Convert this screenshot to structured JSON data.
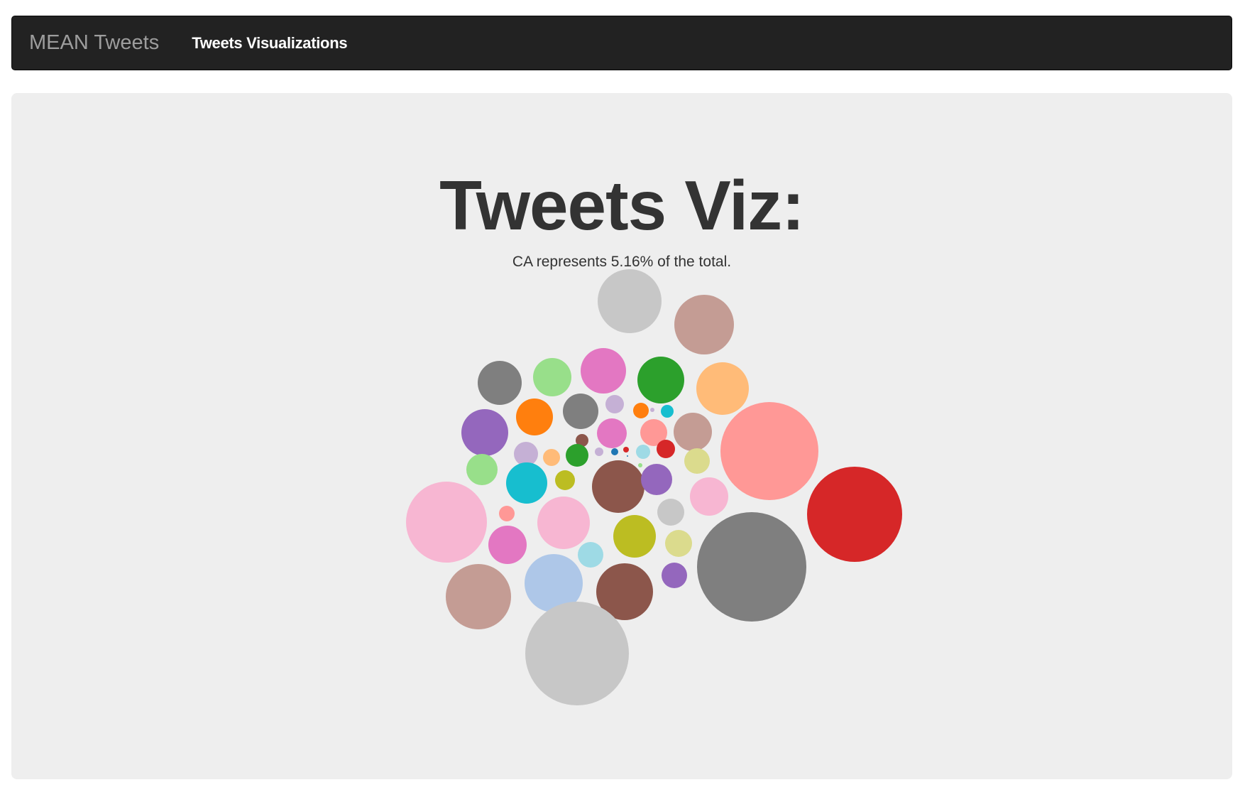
{
  "navbar": {
    "brand": "MEAN Tweets",
    "link": "Tweets Visualizations"
  },
  "page": {
    "title": "Tweets Viz:",
    "subtitle": "CA represents 5.16% of the total."
  },
  "colors": {
    "navbar_bg": "#222222",
    "brand_text": "#9d9d9d",
    "jumbotron_bg": "#eeeeee",
    "heading_text": "#333333",
    "palette": [
      "#1f77b4",
      "#aec7e8",
      "#ff7f0e",
      "#ffbb78",
      "#2ca02c",
      "#98df8a",
      "#d62728",
      "#ff9896",
      "#9467bd",
      "#c5b0d5",
      "#8c564b",
      "#c49c94",
      "#e377c2",
      "#f7b6d2",
      "#7f7f7f",
      "#c7c7c7",
      "#bcbd22",
      "#dbdb8d",
      "#17becf",
      "#9edae5"
    ]
  },
  "chart_data": {
    "type": "bubble",
    "title": "",
    "bubbles": [
      {
        "color": "#c7c7c7",
        "size": 45
      },
      {
        "color": "#c49c94",
        "size": 42
      },
      {
        "color": "#7f7f7f",
        "size": 31
      },
      {
        "color": "#98df8a",
        "size": 27
      },
      {
        "color": "#e377c2",
        "size": 32
      },
      {
        "color": "#2ca02c",
        "size": 33
      },
      {
        "color": "#ffbb78",
        "size": 37
      },
      {
        "color": "#ff7f0e",
        "size": 26
      },
      {
        "color": "#7f7f7f",
        "size": 25
      },
      {
        "color": "#c5b0d5",
        "size": 13
      },
      {
        "color": "#ff7f0e",
        "size": 11
      },
      {
        "color": "#c5b0d5",
        "size": 3
      },
      {
        "color": "#17becf",
        "size": 9
      },
      {
        "color": "#9467bd",
        "size": 33
      },
      {
        "color": "#e377c2",
        "size": 21
      },
      {
        "color": "#ff9896",
        "size": 19
      },
      {
        "color": "#c49c94",
        "size": 27
      },
      {
        "color": "#ff9896",
        "size": 69
      },
      {
        "color": "#8c564b",
        "size": 9
      },
      {
        "color": "#c5b0d5",
        "size": 17
      },
      {
        "color": "#ffbb78",
        "size": 12
      },
      {
        "color": "#2ca02c",
        "size": 16
      },
      {
        "color": "#c5b0d5",
        "size": 6
      },
      {
        "color": "#1f77b4",
        "size": 5
      },
      {
        "color": "#d62728",
        "size": 4
      },
      {
        "color": "#9edae5",
        "size": 10
      },
      {
        "color": "#d62728",
        "size": 13
      },
      {
        "color": "#1f77b4",
        "size": 1
      },
      {
        "color": "#98df8a",
        "size": 3
      },
      {
        "color": "#98df8a",
        "size": 22
      },
      {
        "color": "#17becf",
        "size": 29
      },
      {
        "color": "#bcbd22",
        "size": 14
      },
      {
        "color": "#8c564b",
        "size": 37
      },
      {
        "color": "#9467bd",
        "size": 22
      },
      {
        "color": "#dbdb8d",
        "size": 18
      },
      {
        "color": "#f7b6d2",
        "size": 57
      },
      {
        "color": "#ff9896",
        "size": 11
      },
      {
        "color": "#f7b6d2",
        "size": 37
      },
      {
        "color": "#c7c7c7",
        "size": 19
      },
      {
        "color": "#f7b6d2",
        "size": 27
      },
      {
        "color": "#d62728",
        "size": 67
      },
      {
        "color": "#e377c2",
        "size": 27
      },
      {
        "color": "#bcbd22",
        "size": 30
      },
      {
        "color": "#dbdb8d",
        "size": 19
      },
      {
        "color": "#9edae5",
        "size": 18
      },
      {
        "color": "#c49c94",
        "size": 46
      },
      {
        "color": "#aec7e8",
        "size": 41
      },
      {
        "color": "#8c564b",
        "size": 40
      },
      {
        "color": "#9467bd",
        "size": 18
      },
      {
        "color": "#7f7f7f",
        "size": 77
      },
      {
        "color": "#c7c7c7",
        "size": 73
      }
    ]
  }
}
